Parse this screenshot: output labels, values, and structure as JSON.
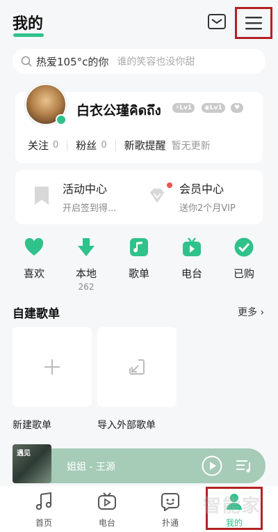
{
  "header": {
    "title": "我的",
    "mail_icon": "mail-icon",
    "menu_icon": "menu-icon"
  },
  "search": {
    "query": "热爱105°c的你",
    "hint": "谁的笑容也没你甜"
  },
  "profile": {
    "username": "白衣公瑾คิดถึง",
    "badges": [
      "Lv1",
      "Lv1"
    ],
    "stats": [
      {
        "label": "关注",
        "value": "0"
      },
      {
        "label": "粉丝",
        "value": "0"
      }
    ],
    "song_alert_label": "新歌提醒",
    "song_alert_status": "暂无更新"
  },
  "activities": [
    {
      "title": "活动中心",
      "subtitle": "开启签到得..."
    },
    {
      "title": "会员中心",
      "subtitle": "送你2个月VIP"
    }
  ],
  "quick_actions": [
    {
      "label": "喜欢",
      "icon": "heart-icon"
    },
    {
      "label": "本地",
      "icon": "download-icon",
      "count": "262"
    },
    {
      "label": "歌单",
      "icon": "music-note-icon"
    },
    {
      "label": "电台",
      "icon": "radio-icon"
    },
    {
      "label": "已购",
      "icon": "check-icon"
    }
  ],
  "playlists": {
    "section_title": "自建歌单",
    "more_label": "更多",
    "tiles": [
      {
        "label": "新建歌单",
        "icon": "plus-icon"
      },
      {
        "label": "导入外部歌单",
        "icon": "import-icon"
      }
    ]
  },
  "player": {
    "cover_text": "遇见",
    "song": "姐姐 - 王源"
  },
  "bottom_nav": [
    {
      "label": "首页",
      "icon": "music-note-icon"
    },
    {
      "label": "电台",
      "icon": "tv-icon"
    },
    {
      "label": "扑通",
      "icon": "chat-icon"
    },
    {
      "label": "我的",
      "icon": "user-icon"
    }
  ],
  "watermark": "智能家",
  "colors": {
    "accent": "#2fc28a",
    "highlight_border": "#b22222",
    "player_bg": "#a6cbb7"
  }
}
